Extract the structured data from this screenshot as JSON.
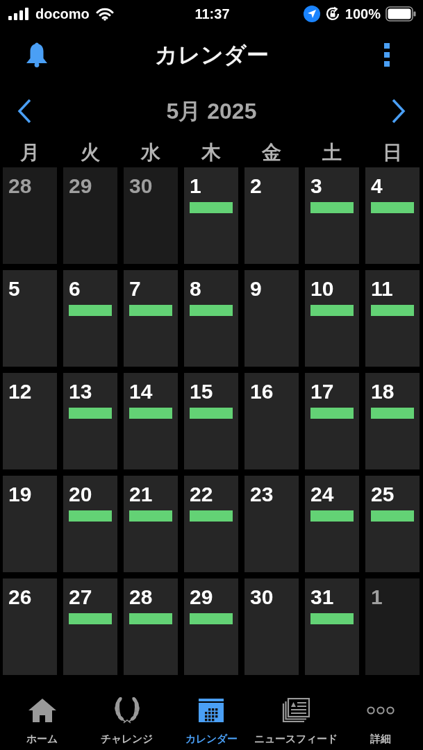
{
  "status_bar": {
    "carrier": "docomo",
    "time": "11:37",
    "battery": "100%"
  },
  "header": {
    "title": "カレンダー"
  },
  "month_nav": {
    "label": "5月 2025"
  },
  "weekdays": [
    "月",
    "火",
    "水",
    "木",
    "金",
    "土",
    "日"
  ],
  "days": [
    {
      "day": "28",
      "in_month": false,
      "event": false
    },
    {
      "day": "29",
      "in_month": false,
      "event": false
    },
    {
      "day": "30",
      "in_month": false,
      "event": false
    },
    {
      "day": "1",
      "in_month": true,
      "event": true
    },
    {
      "day": "2",
      "in_month": true,
      "event": false
    },
    {
      "day": "3",
      "in_month": true,
      "event": true
    },
    {
      "day": "4",
      "in_month": true,
      "event": true
    },
    {
      "day": "5",
      "in_month": true,
      "event": false
    },
    {
      "day": "6",
      "in_month": true,
      "event": true
    },
    {
      "day": "7",
      "in_month": true,
      "event": true
    },
    {
      "day": "8",
      "in_month": true,
      "event": true
    },
    {
      "day": "9",
      "in_month": true,
      "event": false
    },
    {
      "day": "10",
      "in_month": true,
      "event": true
    },
    {
      "day": "11",
      "in_month": true,
      "event": true
    },
    {
      "day": "12",
      "in_month": true,
      "event": false
    },
    {
      "day": "13",
      "in_month": true,
      "event": true
    },
    {
      "day": "14",
      "in_month": true,
      "event": true
    },
    {
      "day": "15",
      "in_month": true,
      "event": true
    },
    {
      "day": "16",
      "in_month": true,
      "event": false
    },
    {
      "day": "17",
      "in_month": true,
      "event": true
    },
    {
      "day": "18",
      "in_month": true,
      "event": true
    },
    {
      "day": "19",
      "in_month": true,
      "event": false
    },
    {
      "day": "20",
      "in_month": true,
      "event": true
    },
    {
      "day": "21",
      "in_month": true,
      "event": true
    },
    {
      "day": "22",
      "in_month": true,
      "event": true
    },
    {
      "day": "23",
      "in_month": true,
      "event": false
    },
    {
      "day": "24",
      "in_month": true,
      "event": true
    },
    {
      "day": "25",
      "in_month": true,
      "event": true
    },
    {
      "day": "26",
      "in_month": true,
      "event": false
    },
    {
      "day": "27",
      "in_month": true,
      "event": true
    },
    {
      "day": "28",
      "in_month": true,
      "event": true
    },
    {
      "day": "29",
      "in_month": true,
      "event": true
    },
    {
      "day": "30",
      "in_month": true,
      "event": false
    },
    {
      "day": "31",
      "in_month": true,
      "event": true
    },
    {
      "day": "1",
      "in_month": false,
      "event": false
    }
  ],
  "tabs": [
    {
      "label": "ホーム",
      "selected": false
    },
    {
      "label": "チャレンジ",
      "selected": false
    },
    {
      "label": "カレンダー",
      "selected": true
    },
    {
      "label": "ニュースフィード",
      "selected": false
    },
    {
      "label": "詳細",
      "selected": false
    }
  ]
}
